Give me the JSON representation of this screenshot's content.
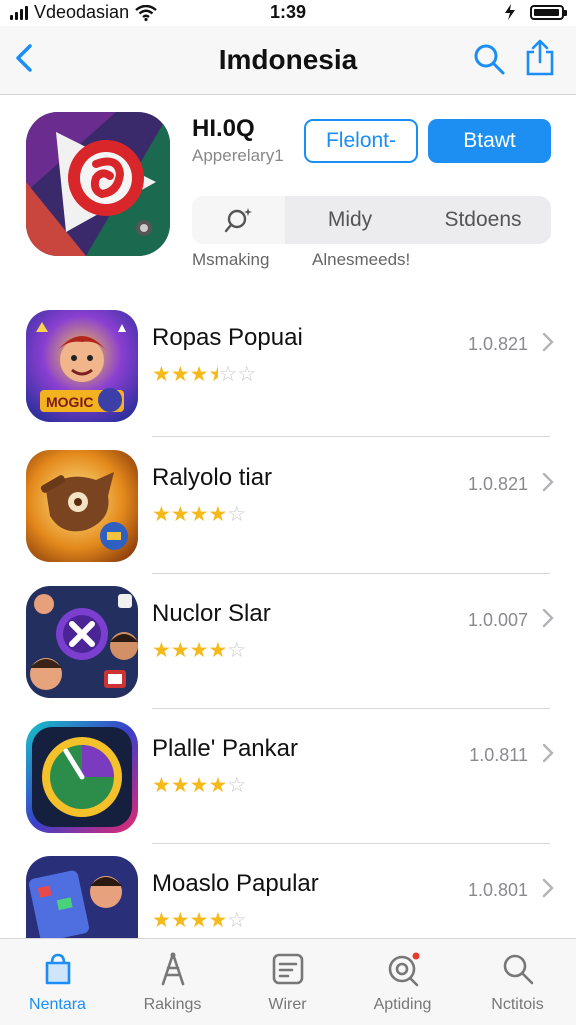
{
  "status_bar": {
    "carrier": "Vdeodasian",
    "time": "1:39"
  },
  "nav": {
    "title": "Imdonesia",
    "back_icon": "chevron-left-icon",
    "search_icon": "search-icon",
    "share_icon": "share-icon"
  },
  "featured": {
    "name": "HI.0Q",
    "subtitle": "Apperelary1",
    "buttons": {
      "secondary": "Flelont-",
      "primary": "Btawt"
    },
    "segments": [
      "Midy",
      "Stdoens"
    ],
    "segment_labels": [
      "Msmaking",
      "Alnesmeeds!"
    ],
    "accent_color": "#1e8ff2"
  },
  "apps": [
    {
      "name": "Ropas Popuai",
      "version": "1.0.821",
      "rating": 3.5
    },
    {
      "name": "Ralyolo tiar",
      "version": "1.0.821",
      "rating": 4
    },
    {
      "name": "Nuclor Slar",
      "version": "1.0.007",
      "rating": 4
    },
    {
      "name": "Plalle' Pankar",
      "version": "1.0.811",
      "rating": 4
    },
    {
      "name": "Moaslo Papular",
      "version": "1.0.801",
      "rating": 4
    }
  ],
  "tabs": [
    {
      "label": "Nentara",
      "icon": "bag-icon",
      "active": true
    },
    {
      "label": "Rakings",
      "icon": "rankings-icon",
      "active": false
    },
    {
      "label": "Wirer",
      "icon": "list-icon",
      "active": false
    },
    {
      "label": "Aptiding",
      "icon": "update-icon",
      "active": false
    },
    {
      "label": "Nctitois",
      "icon": "search-icon",
      "active": false
    }
  ]
}
